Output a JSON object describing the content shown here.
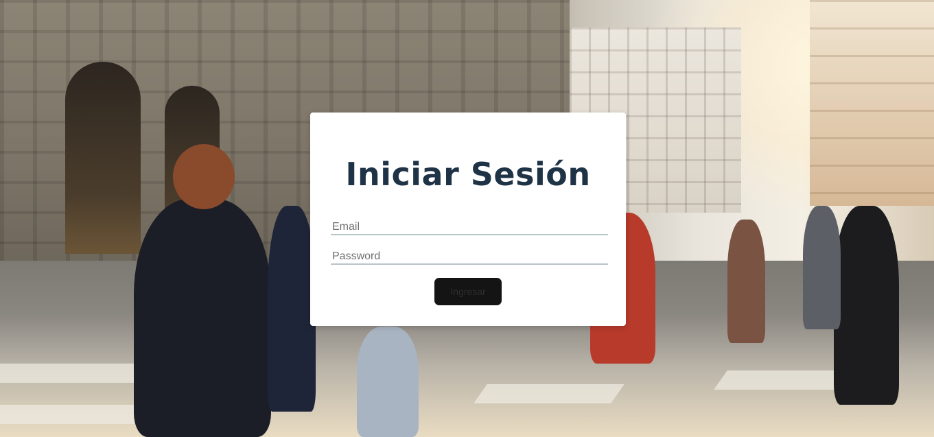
{
  "login": {
    "title": "Iniciar Sesión",
    "email_placeholder": "Email",
    "password_placeholder": "Password",
    "submit_label": "Ingresar"
  }
}
